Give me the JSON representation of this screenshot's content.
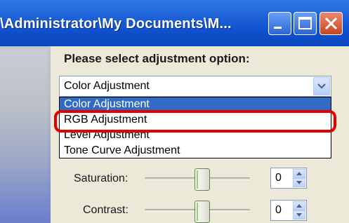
{
  "window": {
    "title": "\\Administrator\\My Documents\\M..."
  },
  "panel": {
    "label": "Please select adjustment option:"
  },
  "combo": {
    "value": "Color Adjustment",
    "options": [
      "Color Adjustment",
      "RGB Adjustment",
      "Level Adjustment",
      "Tone Curve Adjustment"
    ],
    "selected_index": 0,
    "highlighted_option": "RGB Adjustment"
  },
  "controls": [
    {
      "label": "Saturation:",
      "value": "0"
    },
    {
      "label": "Contrast:",
      "value": "0"
    }
  ],
  "colors": {
    "titlebar": "#0f4fcb",
    "selection": "#316ac5",
    "highlight": "#e00000",
    "face": "#ece9d8"
  },
  "icons": [
    "minimize-icon",
    "maximize-icon",
    "close-icon",
    "chevron-down-icon",
    "spin-up-icon",
    "spin-down-icon"
  ]
}
